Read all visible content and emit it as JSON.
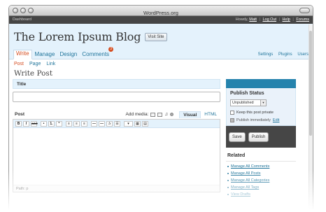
{
  "window": {
    "title": "WordPress.org"
  },
  "adminbar": {
    "dashboard": "Dashboard",
    "howdy": "Howdy,",
    "user": "Matt",
    "links": [
      "Log Out",
      "Help",
      "Forums"
    ]
  },
  "header": {
    "blog_title": "The Lorem Ipsum Blog",
    "visit_site": "Visit Site"
  },
  "menu": {
    "tabs": [
      {
        "label": "Write"
      },
      {
        "label": "Manage"
      },
      {
        "label": "Design"
      },
      {
        "label": "Comments",
        "badge": "3"
      }
    ],
    "right": [
      "Settings",
      "Plugins",
      "Users"
    ]
  },
  "submenu": [
    "Post",
    "Page",
    "Link"
  ],
  "page": {
    "title": "Write Post"
  },
  "title_box": {
    "label": "Title",
    "value": ""
  },
  "editor": {
    "label": "Post",
    "add_media": "Add media:",
    "mode_visual": "Visual",
    "mode_html": "HTML",
    "toolbar": [
      "B",
      "I",
      "ABC",
      "•",
      "1.",
      "“",
      "≡",
      "≡",
      "≡",
      "—",
      "—",
      "✰",
      "☰",
      "▾",
      "▦",
      "▤"
    ],
    "path": "Path: p"
  },
  "publish": {
    "title": "Publish Status",
    "status": "Unpublished",
    "private_label": "Keep this post private",
    "immediately": "Publish immediately",
    "edit": "Edit",
    "save": "Save",
    "publish": "Publish"
  },
  "related": {
    "title": "Related",
    "items": [
      "Manage All Comments",
      "Manage All Posts",
      "Manage All Categories",
      "Manage All Tags",
      "View Drafts"
    ]
  }
}
